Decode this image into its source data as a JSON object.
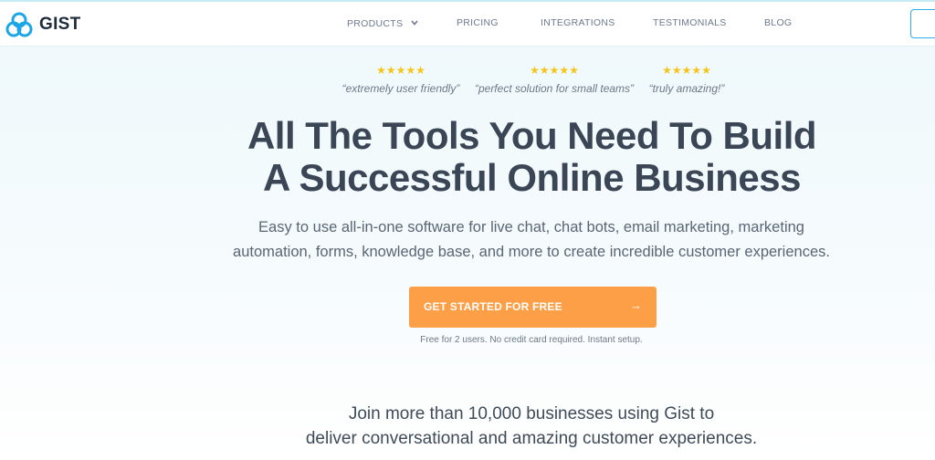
{
  "header": {
    "logo_text": "GIST",
    "brand_color": "#1ca6e8",
    "nav": {
      "products": "PRODUCTS",
      "pricing": "PRICING",
      "integrations": "INTEGRATIONS",
      "testimonials": "TESTIMONIALS",
      "blog": "BLOG"
    }
  },
  "reviews": [
    {
      "stars": "★★★★★",
      "quote": "“extremely user friendly”"
    },
    {
      "stars": "★★★★★",
      "quote": "“perfect solution for small teams”"
    },
    {
      "stars": "★★★★★",
      "quote": "“truly amazing!”"
    }
  ],
  "hero": {
    "headline_line1": "All The Tools You Need To Build",
    "headline_line2": "A Successful Online Business",
    "subtext_line1": "Easy to use all-in-one software for live chat, chat bots, email marketing, marketing",
    "subtext_line2": "automation, forms, knowledge base, and more to create incredible customer experiences.",
    "cta_label": "GET STARTED FOR FREE",
    "cta_arrow": "→",
    "cta_color": "#fd9f47",
    "cta_note": "Free for 2 users. No credit card required. Instant setup."
  },
  "social_proof": {
    "line1": "Join more than 10,000 businesses using Gist to",
    "line2": "deliver conversational and amazing customer experiences."
  }
}
